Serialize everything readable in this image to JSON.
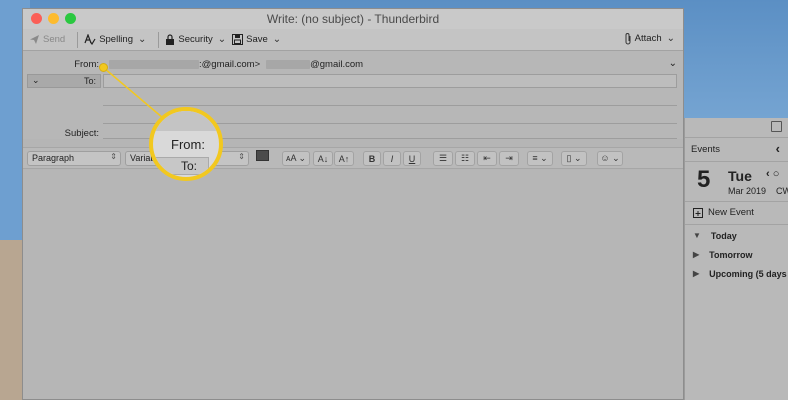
{
  "window": {
    "title": "Write: (no subject) - Thunderbird",
    "traffic_lights": [
      "#fb5f57",
      "#fdbb2e",
      "#2ac840"
    ]
  },
  "toolbar": {
    "send_label": "Send",
    "spelling_label": "Spelling",
    "security_label": "Security",
    "save_label": "Save",
    "attach_label": "Attach"
  },
  "header": {
    "from_label": "From:",
    "from_value_main": ":@gmail.com>",
    "from_value_secondary": "@gmail.com",
    "to_label": "To:",
    "subject_label": "Subject:"
  },
  "format_bar": {
    "paragraph_select": "Paragraph",
    "font_select": "Variab",
    "text_color": "#4b4b4b"
  },
  "calendar": {
    "events_label": "Events",
    "day_number": "5",
    "day_name": "Tue",
    "month_year": "Mar 2019",
    "week": "CW",
    "new_event_label": "New Event",
    "groups": [
      "Today",
      "Tomorrow",
      "Upcoming (5 days"
    ]
  },
  "magnifier": {
    "from_label": "From:",
    "to_label": "To:",
    "accent": "#f2c81f"
  }
}
